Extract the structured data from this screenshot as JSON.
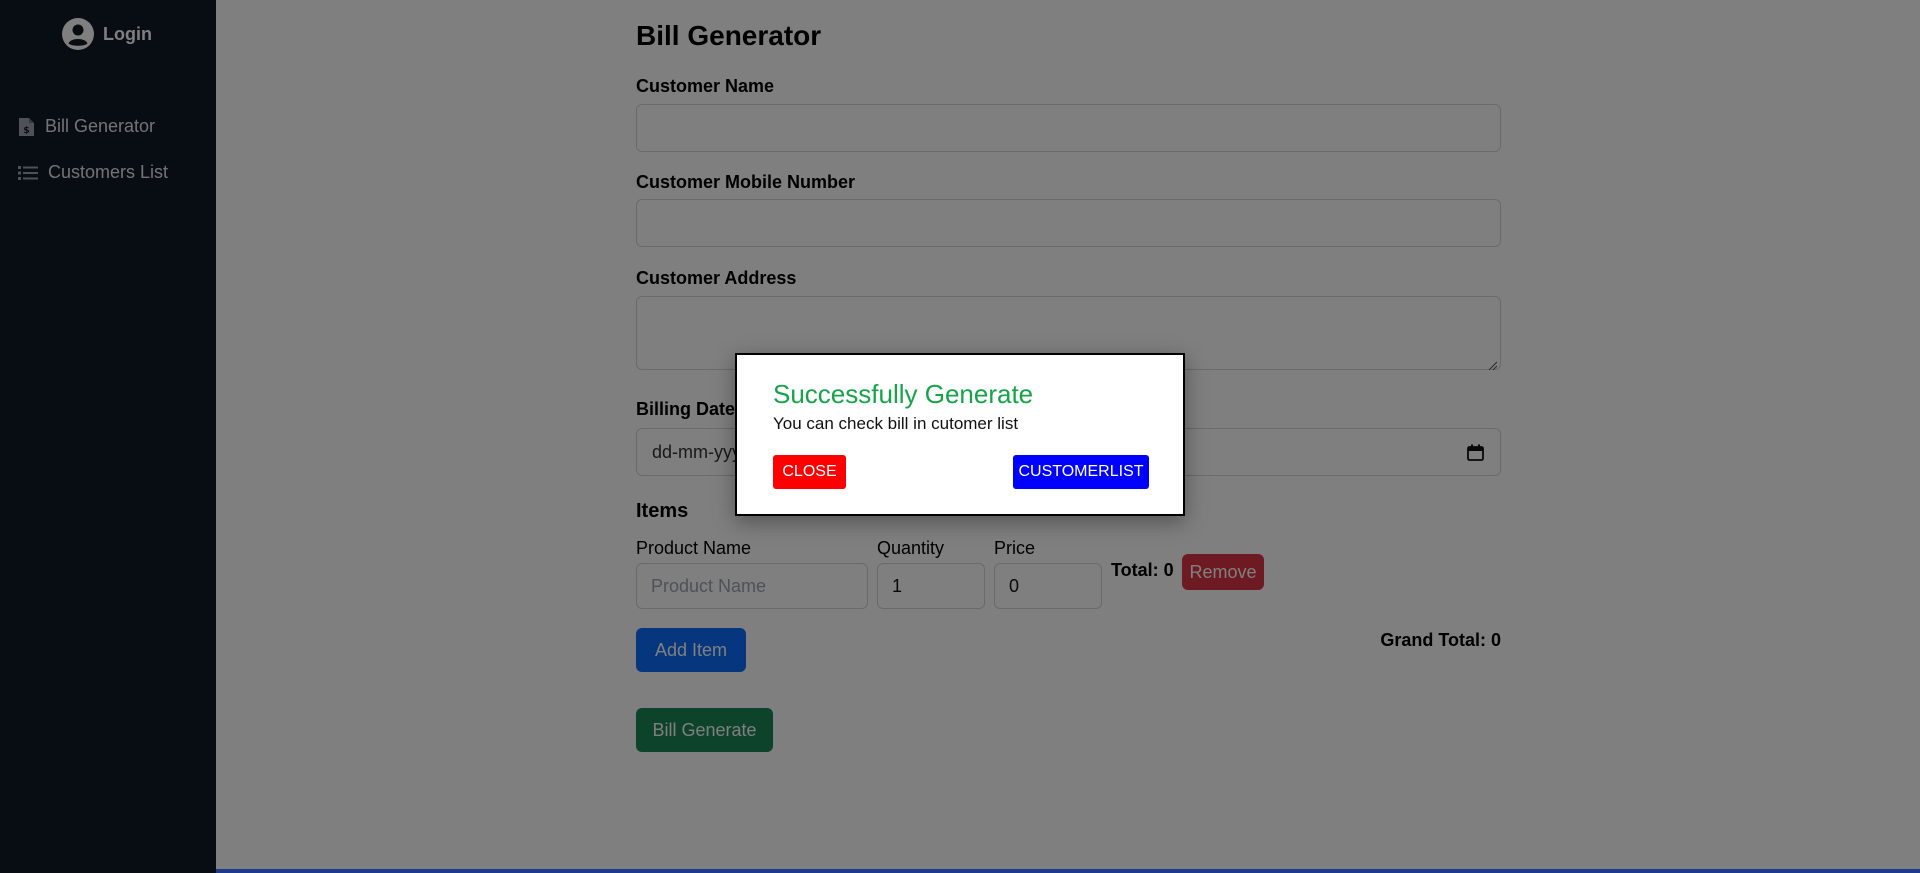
{
  "sidebar": {
    "login_label": "Login",
    "items": [
      {
        "label": "Bill Generator",
        "icon": "invoice-icon"
      },
      {
        "label": "Customers List",
        "icon": "list-icon"
      }
    ]
  },
  "form": {
    "title": "Bill Generator",
    "customer_name_label": "Customer Name",
    "customer_name_value": "",
    "mobile_label": "Customer Mobile Number",
    "mobile_value": "",
    "address_label": "Customer Address",
    "address_value": "",
    "billing_date_label": "Billing Date",
    "billing_date_placeholder": "dd-mm-yyyy",
    "items_title": "Items",
    "columns": {
      "product": "Product Name",
      "quantity": "Quantity",
      "price": "Price"
    },
    "item_row": {
      "product_placeholder": "Product Name",
      "quantity": "1",
      "price": "0",
      "total": "Total: 0",
      "remove_label": "Remove"
    },
    "add_item_label": "Add Item",
    "grand_total": "Grand Total: 0",
    "bill_generate_label": "Bill Generate"
  },
  "modal": {
    "title": "Successfully Generate",
    "message": "You can check bill in cutomer list",
    "close_label": "CLOSE",
    "customerlist_label": "CUSTOMERLIST"
  },
  "colors": {
    "sidebar_bg": "#111827",
    "success_title": "#16a34a",
    "close_button": "#ff0000",
    "customerlist_button": "#0000ff",
    "add_item_button": "#0d6efd",
    "bill_generate_button": "#198754",
    "remove_button": "#dc3545"
  }
}
